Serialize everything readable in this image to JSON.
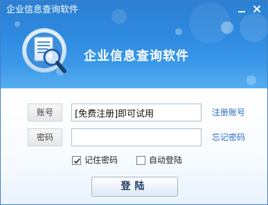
{
  "window": {
    "title": "企业信息查询软件",
    "app_name": "企业信息查询软件"
  },
  "icons": {
    "logo": "document-search-icon",
    "minimize": "minimize-icon",
    "close": "close-icon"
  },
  "form": {
    "account_label": "账号",
    "account_value": "[免费注册]即可试用",
    "register_link": "注册账号",
    "password_label": "密码",
    "password_value": "",
    "forgot_link": "忘记密码",
    "remember_label": "记住密码",
    "remember_checked": true,
    "autologin_label": "自动登陆",
    "autologin_checked": false,
    "login_button": "登陆"
  },
  "colors": {
    "banner": "#2e8ae0",
    "link": "#2b6cc4",
    "border": "#3f7fc6"
  }
}
